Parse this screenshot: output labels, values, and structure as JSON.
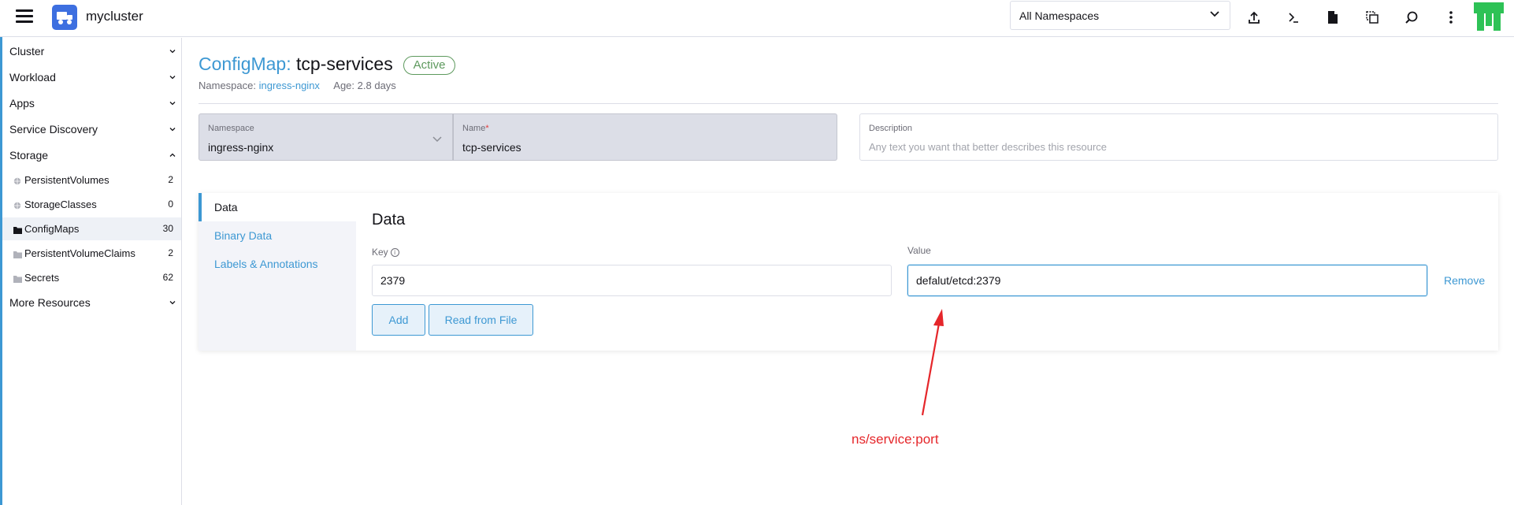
{
  "header": {
    "cluster_name": "mycluster",
    "namespace_filter": "All Namespaces",
    "icons": [
      "import-icon",
      "shell-icon",
      "file-icon",
      "copy-config-icon",
      "search-icon",
      "more-icon"
    ]
  },
  "sidebar": {
    "groups": {
      "cluster": "Cluster",
      "workload": "Workload",
      "apps": "Apps",
      "service_discovery": "Service Discovery",
      "storage": "Storage",
      "more_resources": "More Resources"
    },
    "storage_items": [
      {
        "label": "PersistentVolumes",
        "count": "2"
      },
      {
        "label": "StorageClasses",
        "count": "0"
      },
      {
        "label": "ConfigMaps",
        "count": "30"
      },
      {
        "label": "PersistentVolumeClaims",
        "count": "2"
      },
      {
        "label": "Secrets",
        "count": "62"
      }
    ]
  },
  "page": {
    "kind": "ConfigMap:",
    "name": "tcp-services",
    "status": "Active",
    "namespace_label": "Namespace:",
    "namespace_value": "ingress-nginx",
    "age_label": "Age:",
    "age_value": "2.8 days"
  },
  "form": {
    "namespace_label": "Namespace",
    "namespace_value": "ingress-nginx",
    "name_label": "Name",
    "name_required": "*",
    "name_value": "tcp-services",
    "description_label": "Description",
    "description_placeholder": "Any text you want that better describes this resource"
  },
  "tabs": {
    "items": [
      "Data",
      "Binary Data",
      "Labels & Annotations"
    ]
  },
  "data_section": {
    "heading": "Data",
    "key_label": "Key",
    "value_label": "Value",
    "key_value": "2379",
    "value_value": "defalut/etcd:2379",
    "remove_label": "Remove",
    "add_label": "Add",
    "read_file_label": "Read from File"
  },
  "annotation": {
    "text": "ns/service:port",
    "color": "#e5262a"
  },
  "colors": {
    "accent": "#3d98d3",
    "active_badge": "#5d995d"
  }
}
